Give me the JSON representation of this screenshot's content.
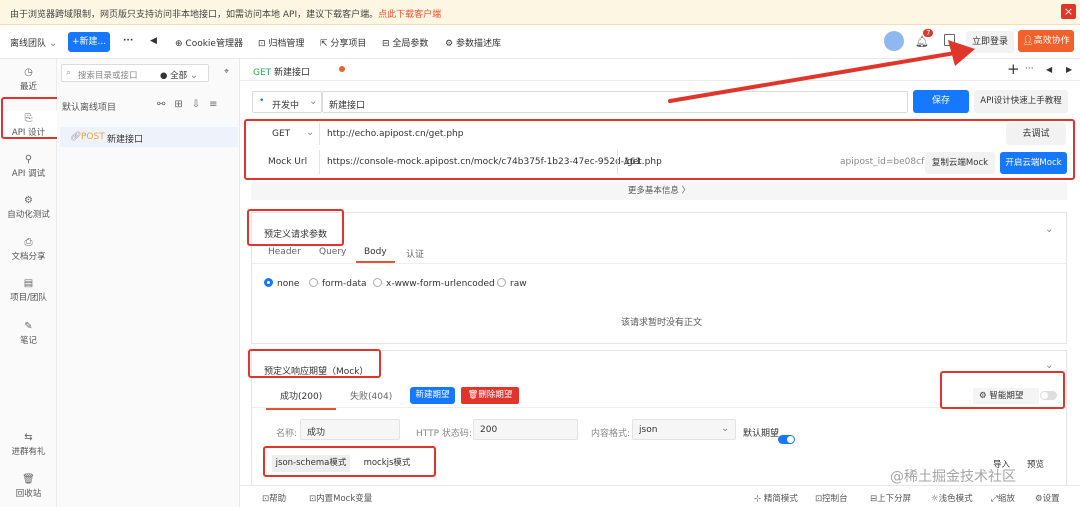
{
  "notice": {
    "text": "由于浏览器跨域限制，网页版只支持访问非本地接口，如需访问本地 API，建议下载客户端。",
    "link": "点此下载客户端",
    "close": "×"
  },
  "topbar": {
    "team": "离线团队",
    "team_caret": "⌄",
    "new_button": "+新建...",
    "more": "···",
    "back": "◀",
    "cookie": "Cookie管理器",
    "archive": "归档管理",
    "share": "分享项目",
    "global_params": "全局参数",
    "param_desc": "参数描述库",
    "notif_count": "7",
    "login": "立即登录",
    "collab": "高效协作"
  },
  "sidebar": {
    "items": [
      {
        "icon": "◷",
        "label": "最近"
      },
      {
        "icon": "⎘",
        "label": "API 设计"
      },
      {
        "icon": "⚲",
        "label": "API 调试"
      },
      {
        "icon": "⚙",
        "label": "自动化测试"
      },
      {
        "icon": "⎙",
        "label": "文档分享"
      },
      {
        "icon": "▤",
        "label": "项目/团队"
      },
      {
        "icon": "✎",
        "label": "笔记"
      },
      {
        "icon": "⇆",
        "label": "进群有礼"
      },
      {
        "icon": "🗑",
        "label": "回收站"
      }
    ]
  },
  "tree": {
    "search_placeholder": "搜索目录或接口",
    "filter": "全部",
    "project": "默认离线项目",
    "item_method": "POST",
    "item_name": "新建接口"
  },
  "tab": {
    "method": "GET",
    "name": "新建接口",
    "plus": "+",
    "more": "···"
  },
  "request": {
    "env": "开发中",
    "name": "新建接口",
    "save": "保存",
    "tutorial": "API设计快速上手教程",
    "method": "GET",
    "url": "http://echo.apipost.cn/get.php",
    "debug": "去调试",
    "mock_label": "Mock Url",
    "mock_url": "https://console-mock.apipost.cn/mock/c74b375f-1b23-47ec-952d-161",
    "mock_path": "/get.php",
    "mock_id": "apipost_id=be08cf",
    "copy_mock": "复制云端Mock",
    "open_mock": "开启云端Mock",
    "more_info": "更多基本信息 〉"
  },
  "predefine_req": {
    "title": "预定义请求参数",
    "tabs": [
      "Header",
      "Query",
      "Body",
      "认证"
    ],
    "radios": [
      "none",
      "form-data",
      "x-www-form-urlencoded",
      "raw"
    ],
    "empty": "该请求暂时没有正文"
  },
  "predefine_resp": {
    "title": "预定义响应期望（Mock）",
    "tab_success": "成功(200)",
    "tab_fail": "失败(404)",
    "new_expect": "新建期望",
    "del_expect": "删除期望",
    "smart": "智能期望",
    "name_label": "名称:",
    "name_value": "成功",
    "status_label": "HTTP 状态码:",
    "status_value": "200",
    "format_label": "内容格式:",
    "format_value": "json",
    "default_label": "默认期望",
    "schema_mode": "json-schema模式",
    "mockjs_mode": "mockjs模式",
    "import": "导入",
    "preview": "预览"
  },
  "statusbar": {
    "help": "帮助",
    "mock_vars": "内置Mock变量",
    "simple": "精简模式",
    "console": "控制台",
    "split": "上下分屏",
    "theme": "浅色模式",
    "zoom": "缩放",
    "settings": "设置"
  },
  "watermark": "@稀土掘金技术社区",
  "colors": {
    "accent": "#1677ff",
    "brand_orange": "#f0612c",
    "annotation_red": "#e0352b"
  }
}
